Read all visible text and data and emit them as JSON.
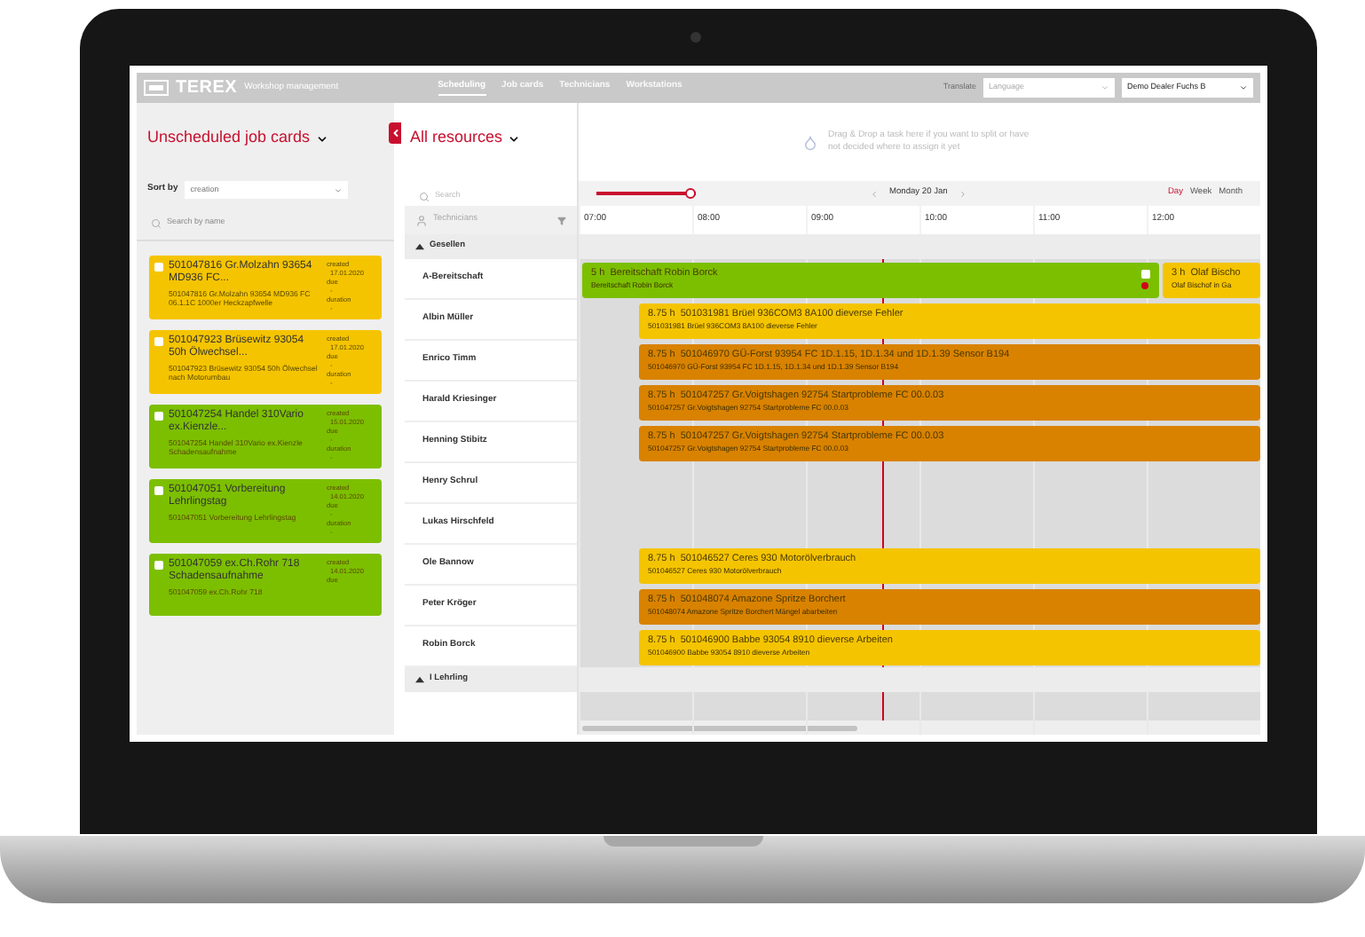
{
  "header": {
    "brand": "TEREX",
    "subtitle": "Workshop management",
    "nav": [
      {
        "label": "Scheduling",
        "selected": true
      },
      {
        "label": "Job cards",
        "selected": false
      },
      {
        "label": "Technicians",
        "selected": false
      },
      {
        "label": "Workstations",
        "selected": false
      }
    ],
    "translate": "Translate",
    "language": {
      "placeholder": "Language"
    },
    "dealer": "Demo Dealer Fuchs B"
  },
  "unscheduled": {
    "title": "Unscheduled job cards",
    "sort_label": "Sort by",
    "sort_value": "creation",
    "search_placeholder": "Search by name",
    "cards": [
      {
        "title": "501047816 Gr.Molzahn 93654 MD936 FC...",
        "description": "501047816 Gr.Molzahn 93654 MD936 FC 06.1.1C 1000er Heckzapfwelle",
        "color": "#f5c400",
        "checked": false,
        "created_label": "created",
        "created": "17.01.2020",
        "due_label": "due",
        "due": "-",
        "duration_label": "duration",
        "duration": "-"
      },
      {
        "title": "501047923 Brüsewitz 93054 50h Ölwechsel...",
        "description": "501047923 Brüsewitz 93054 50h Ölwechsel nach Motorumbau",
        "color": "#f5c400",
        "checked": false,
        "created_label": "created",
        "created": "17.01.2020",
        "due_label": "due",
        "due": "-",
        "duration_label": "duration",
        "duration": "-"
      },
      {
        "title": "501047254 Handel 310Vario ex.Kienzle...",
        "description": "501047254 Handel 310Vario ex.Kienzle Schadensaufnahme",
        "color": "#7cbf00",
        "checked": false,
        "created_label": "created",
        "created": "15.01.2020",
        "due_label": "due",
        "due": "-",
        "duration_label": "duration",
        "duration": "-"
      },
      {
        "title": "501047051 Vorbereitung Lehrlingstag",
        "description": "501047051 Vorbereitung Lehrlingstag",
        "color": "#7cbf00",
        "checked": false,
        "created_label": "created",
        "created": "14.01.2020",
        "due_label": "due",
        "due": "-",
        "duration_label": "duration",
        "duration": "-"
      },
      {
        "title": "501047059 ex.Ch.Rohr 718 Schadensaufnahme",
        "description": "501047059 ex.Ch.Rohr 718",
        "color": "#7cbf00",
        "checked": false,
        "created_label": "created",
        "created": "14.01.2020",
        "due_label": "due"
      }
    ]
  },
  "resources": {
    "title": "All resources",
    "search_placeholder": "Search",
    "technicians_label": "Technicians",
    "groups": [
      {
        "label": "Gesellen",
        "expanded": true,
        "members": [
          {
            "name": "A-Bereitschaft",
            "tasks": [
              {
                "hours": "5 h",
                "title": "Bereitschaft Robin Borck",
                "subtitle": "Bereitschaft Robin Borck",
                "color": "#7cbf00",
                "checked": false,
                "alert": true
              },
              {
                "hours": "3 h",
                "title": "Olaf Bischo",
                "subtitle": "Olaf Bischof in Ga",
                "color": "#f5c400"
              }
            ]
          },
          {
            "name": "Albin Müller",
            "tasks": [
              {
                "hours": "8.75 h",
                "title": "501031981 Brüel 936COM3 8A100 dieverse Fehler",
                "subtitle": "501031981 Brüel 936COM3 8A100 dieverse Fehler",
                "color": "#f5c400"
              }
            ]
          },
          {
            "name": "Enrico Timm",
            "tasks": [
              {
                "hours": "8.75 h",
                "title": "501046970 GÜ-Forst 93954 FC 1D.1.15, 1D.1.34 und 1D.1.39 Sensor B194",
                "subtitle": "501046970 GÜ-Forst 93954 FC 1D.1.15, 1D.1.34 und 1D.1.39 Sensor B194",
                "color": "#d98200"
              }
            ]
          },
          {
            "name": "Harald Kriesinger",
            "tasks": [
              {
                "hours": "8.75 h",
                "title": "501047257 Gr.Voigtshagen 92754 Startprobleme FC 00.0.03",
                "subtitle": "501047257 Gr.Voigtshagen 92754 Startprobleme FC 00.0.03",
                "color": "#d98200"
              }
            ]
          },
          {
            "name": "Henning Stibitz",
            "tasks": [
              {
                "hours": "8.75 h",
                "title": "501047257 Gr.Voigtshagen 92754 Startprobleme FC 00.0.03",
                "subtitle": "501047257 Gr.Voigtshagen 92754 Startprobleme FC 00.0.03",
                "color": "#d98200"
              }
            ]
          },
          {
            "name": "Henry Schrul"
          },
          {
            "name": "Lukas Hirschfeld"
          },
          {
            "name": "Ole Bannow",
            "tasks": [
              {
                "hours": "8.75 h",
                "title": "501046527 Ceres 930 Motorölverbrauch",
                "subtitle": "501046527 Ceres 930 Motorölverbrauch",
                "color": "#f5c400"
              }
            ]
          },
          {
            "name": "Peter Kröger",
            "tasks": [
              {
                "hours": "8.75 h",
                "title": "501048074 Amazone Spritze Borchert",
                "subtitle": "501048074 Amazone Spritze Borchert Mängel abarbeiten",
                "color": "#d98200"
              }
            ]
          },
          {
            "name": "Robin Borck",
            "tasks": [
              {
                "hours": "8.75 h",
                "title": "501046900 Babbe 93054 8910 dieverse Arbeiten",
                "subtitle": "501046900 Babbe 93054 8910 dieverse Arbeiten",
                "color": "#f5c400"
              }
            ]
          }
        ]
      },
      {
        "label": "I Lehrling",
        "expanded": true
      }
    ]
  },
  "timeline": {
    "drop_hint": "Drag & Drop a task here if you want to split or have not decided where to assign it yet",
    "zoom": {
      "level": 1
    },
    "date": "Monday 20 Jan",
    "views": [
      {
        "label": "Day",
        "selected": true
      },
      {
        "label": "Week",
        "selected": false
      },
      {
        "label": "Month",
        "selected": false
      }
    ],
    "hours": [
      "07:00",
      "08:00",
      "09:00",
      "10:00",
      "11:00",
      "12:00"
    ]
  }
}
